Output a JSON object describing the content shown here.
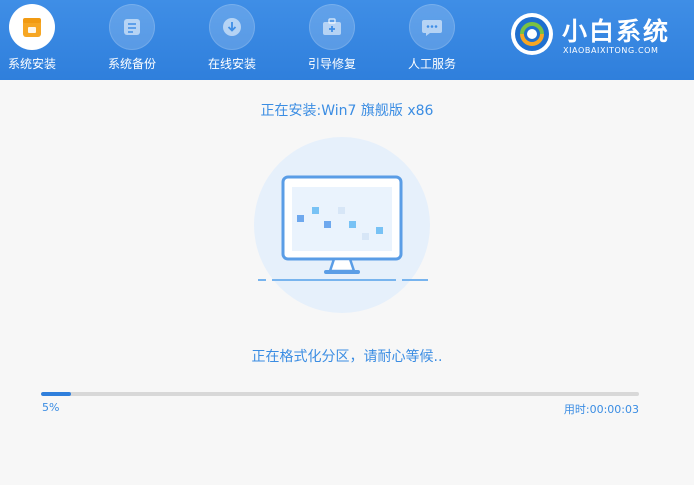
{
  "nav": {
    "items": [
      {
        "label": "系统安装",
        "icon": "system-install-icon",
        "active": true
      },
      {
        "label": "系统备份",
        "icon": "system-backup-icon",
        "active": false
      },
      {
        "label": "在线安装",
        "icon": "online-install-icon",
        "active": false
      },
      {
        "label": "引导修复",
        "icon": "boot-repair-icon",
        "active": false
      },
      {
        "label": "人工服务",
        "icon": "chat-service-icon",
        "active": false
      }
    ]
  },
  "brand": {
    "name": "小白系统",
    "subtitle": "XIAOBAIXITONG.COM"
  },
  "install": {
    "title": "正在安装:Win7 旗舰版 x86",
    "status": "正在格式化分区，请耐心等候..",
    "progress_percent": 5,
    "progress_label": "5%",
    "elapsed_label": "用时:00:00:03"
  },
  "colors": {
    "topbar": "#2f7fdc",
    "accent": "#3b8de3",
    "active_icon": "#f6a623",
    "background": "#f7f7f7"
  }
}
